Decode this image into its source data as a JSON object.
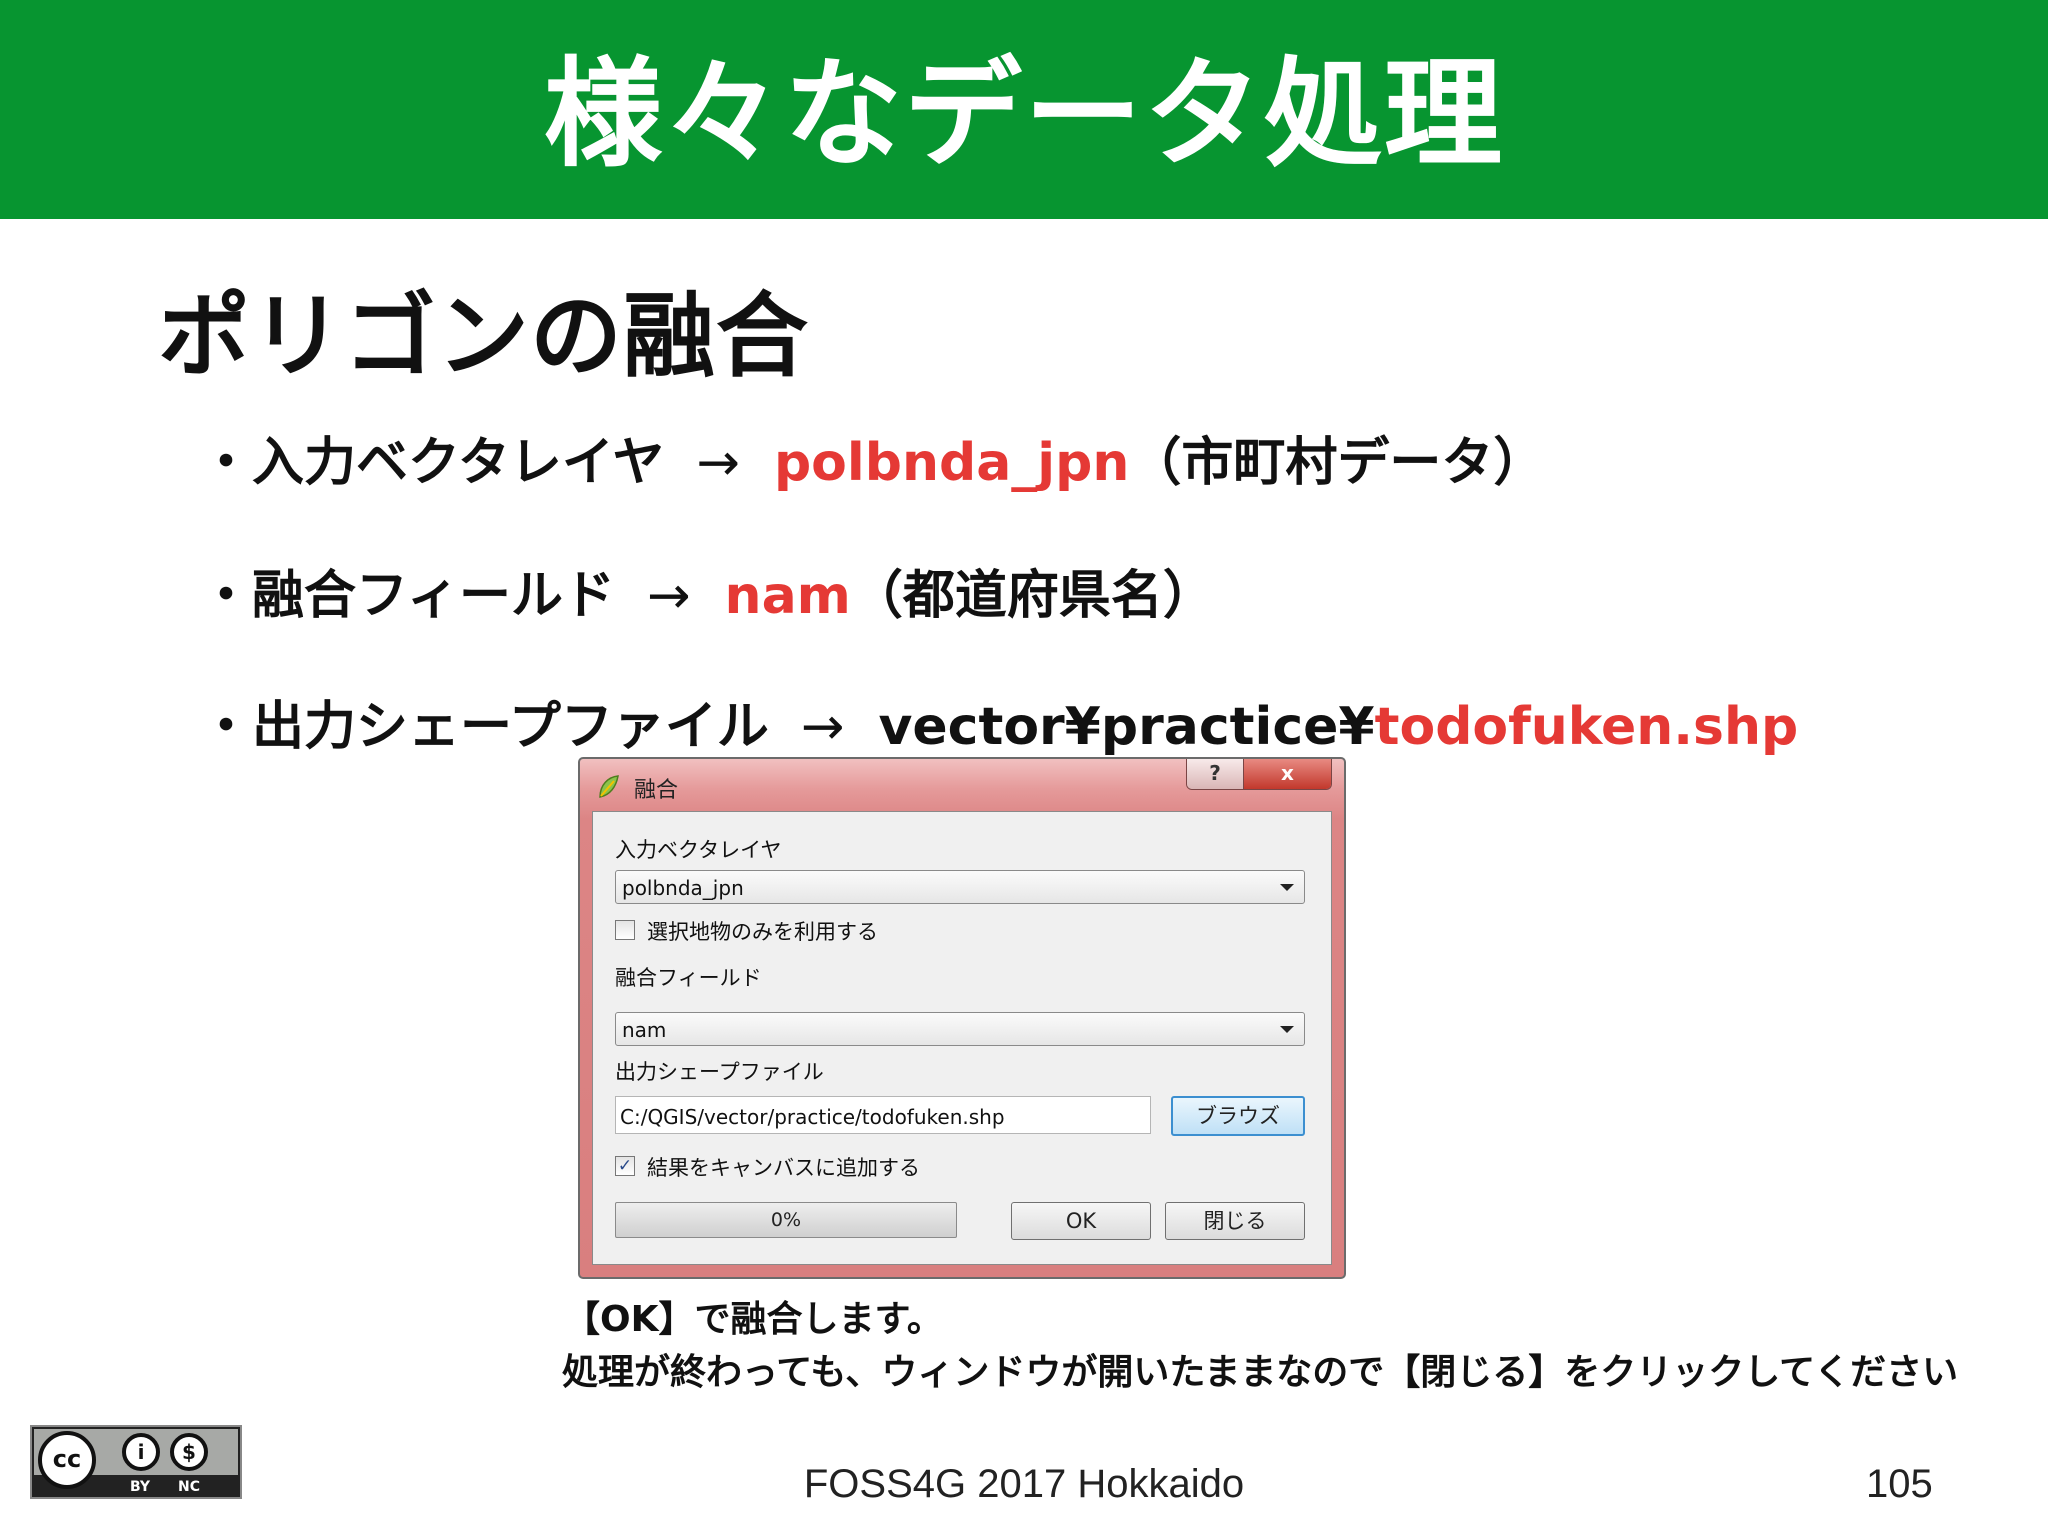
{
  "slide": {
    "header_title": "様々なデータ処理",
    "subtitle": "ポリゴンの融合",
    "bullets": [
      {
        "label": "・入力ベクタレイヤ",
        "arrow": "→",
        "value_red": "polbnda_jpn",
        "value_after": "（市町村データ）"
      },
      {
        "label": "・融合フィールド",
        "arrow": "→",
        "value_red": "nam",
        "value_after": "（都道府県名）"
      },
      {
        "label": "・出力シェープファイル",
        "arrow": "→",
        "value_black": "vector¥practice¥",
        "value_red": "todofuken.shp"
      }
    ],
    "notes": [
      "【OK】で融合します。",
      "処理が終わっても、ウィンドウが開いたままなので【閉じる】をクリックしてください"
    ],
    "footer": "FOSS4G 2017 Hokkaido",
    "page_number": "105",
    "license": {
      "by": "BY",
      "nc": "NC",
      "cc": "cc"
    },
    "colors": {
      "header_bg": "#079530",
      "accent_red": "#e53935"
    }
  },
  "dialog": {
    "title": "融合",
    "help_label": "?",
    "close_label": "x",
    "input_layer_label": "入力ベクタレイヤ",
    "input_layer_value": "polbnda_jpn",
    "selected_only_label": "選択地物のみを利用する",
    "selected_only_checked": false,
    "dissolve_field_label": "融合フィールド",
    "dissolve_field_value": "nam",
    "output_label": "出力シェープファイル",
    "output_value": "C:/QGIS/vector/practice/todofuken.shp",
    "browse_label": "ブラウズ",
    "add_to_canvas_label": "結果をキャンバスに追加する",
    "add_to_canvas_checked": true,
    "progress_text": "0%",
    "progress_fraction": 0.0,
    "ok_label": "OK",
    "close_button_label": "閉じる"
  }
}
